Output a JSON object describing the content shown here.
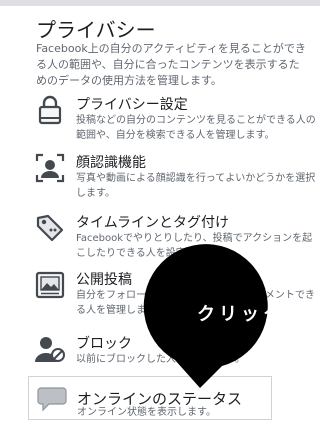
{
  "section": {
    "title": "プライバシー",
    "description": "Facebook上の自分のアクティビティを見ることができる人の範囲や、自分に合ったコンテンツを表示するためのデータの使用方法を管理します。"
  },
  "items": [
    {
      "label": "プライバシー設定",
      "description": "投稿などの自分のコンテンツを見ることができる人の範囲や、自分を検索できる人を管理します。",
      "icon": "lock-icon"
    },
    {
      "label": "顔認識機能",
      "description": "写真や動画による顔認識を行ってよいかどうかを選択します。",
      "icon": "face-recognition-icon"
    },
    {
      "label": "タイムラインとタグ付け",
      "description": "Facebookでやりとりしたり、投稿でアクションを起こしたりできる人を設定します。",
      "icon": "tag-icon"
    },
    {
      "label": "公開投稿",
      "description": "自分をフォローできる人や、公開投稿にコメントできる人を管理します。",
      "icon": "public-post-icon"
    },
    {
      "label": "ブロック",
      "description": "以前にブロックした人を確認します。",
      "icon": "blocked-user-icon"
    },
    {
      "label": "オンラインのステータス",
      "description": "オンライン状態を表示します。",
      "icon": "chat-bubble-icon"
    }
  ],
  "callout": {
    "text": "クリック"
  },
  "colors": {
    "text": "#1c1e21",
    "secondary_text": "#606770",
    "icon": "#444950",
    "callout": "#000000"
  }
}
